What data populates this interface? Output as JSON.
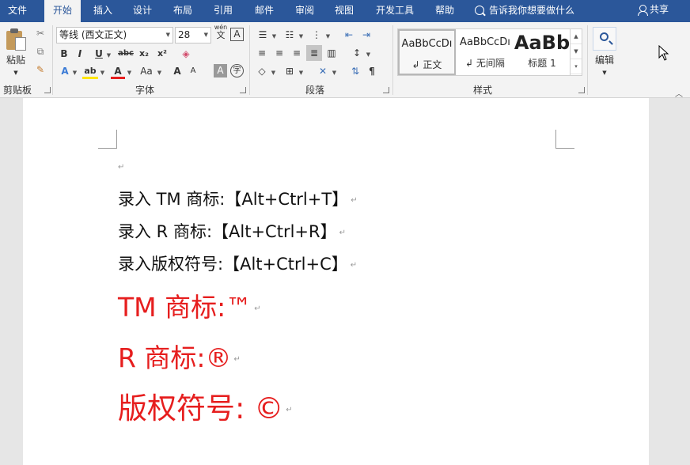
{
  "menu": {
    "tabs": [
      "文件",
      "开始",
      "插入",
      "设计",
      "布局",
      "引用",
      "邮件",
      "审阅",
      "视图",
      "开发工具",
      "帮助"
    ],
    "active_tab": "开始",
    "tellme": "告诉我你想要做什么",
    "share": "共享"
  },
  "ribbon": {
    "clipboard": {
      "paste": "粘贴",
      "label": "剪贴板"
    },
    "font": {
      "name": "等线 (西文正文)",
      "size": "28",
      "wen": "wén",
      "wen_char": "文",
      "a_box": "A",
      "bold": "B",
      "italic": "I",
      "underline": "U",
      "strike": "abc",
      "sub": "x₂",
      "sup": "x²",
      "grow": "A",
      "shrink": "A",
      "case": "Aa",
      "char_shade": "A",
      "enclose": "字",
      "font_color": "A",
      "highlight": "ab",
      "label": "字体"
    },
    "paragraph": {
      "label": "段落"
    },
    "styles": {
      "items": [
        {
          "sample": "AaBbCcDı",
          "name": "正文"
        },
        {
          "sample": "AaBbCcDı",
          "name": "无间隔"
        },
        {
          "sample": "AaBb",
          "name": "标题 1"
        }
      ],
      "label": "样式"
    },
    "editing": {
      "label": "编辑"
    }
  },
  "document": {
    "empty_mark": "↵",
    "lines": [
      {
        "text": "录入 TM 商标:【Alt+Ctrl+T】",
        "mark": "↵"
      },
      {
        "text": "录入 R 商标:【Alt+Ctrl+R】",
        "mark": "↵"
      },
      {
        "text": "录入版权符号:【Alt+Ctrl+C】",
        "mark": "↵"
      },
      {
        "text": "TM 商标:™",
        "mark": "↵"
      },
      {
        "text": "R 商标:®",
        "mark": "↵"
      },
      {
        "text": "版权符号: ©",
        "mark": "↵"
      }
    ],
    "text_color": "#e61e1e"
  },
  "colors": {
    "title_bar": "#2b579a",
    "ribbon_bg": "#f3f3f3",
    "doc_bg": "#e6e6e6"
  }
}
